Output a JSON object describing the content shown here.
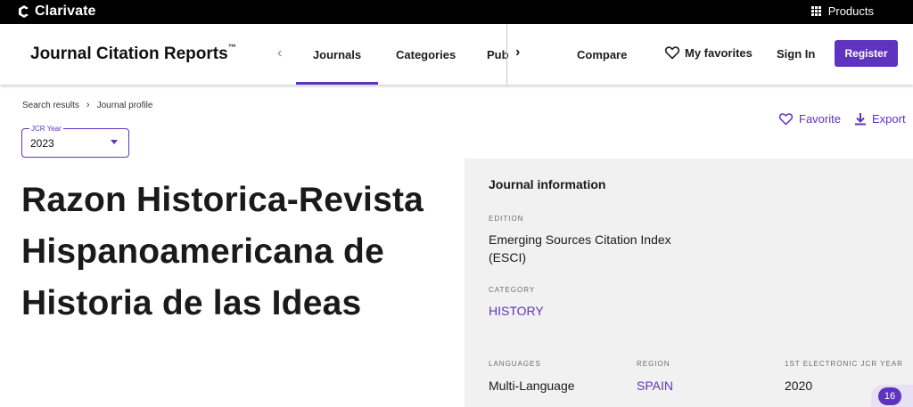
{
  "topbar": {
    "brand": "Clarivate",
    "products_label": "Products"
  },
  "header": {
    "app_title": "Journal Citation Reports",
    "app_title_mark": "™",
    "tabs": [
      {
        "label": "Journals"
      },
      {
        "label": "Categories"
      },
      {
        "label": "Publishers"
      }
    ],
    "compare": "Compare",
    "my_favorites": "My favorites",
    "sign_in": "Sign In",
    "register": "Register"
  },
  "breadcrumb": {
    "items": [
      "Search results",
      "Journal profile"
    ]
  },
  "jcr_year": {
    "label": "JCR Year",
    "value": "2023"
  },
  "actions": {
    "favorite": "Favorite",
    "export": "Export"
  },
  "journal": {
    "title": "Razon Historica-Revista Hispanoamericana de Historia de las Ideas"
  },
  "info": {
    "heading": "Journal information",
    "edition_label": "EDITION",
    "edition_value": "Emerging Sources Citation Index (ESCI)",
    "category_label": "CATEGORY",
    "category_value": "HISTORY",
    "languages_label": "LANGUAGES",
    "languages_value": "Multi-Language",
    "region_label": "REGION",
    "region_value": "SPAIN",
    "first_jcr_label": "1ST ELECTRONIC JCR YEAR",
    "first_jcr_value": "2020"
  },
  "help": {
    "count": "16"
  },
  "colors": {
    "accent": "#5e33bf",
    "panel": "#f1f1f1",
    "topbar": "#000000"
  }
}
